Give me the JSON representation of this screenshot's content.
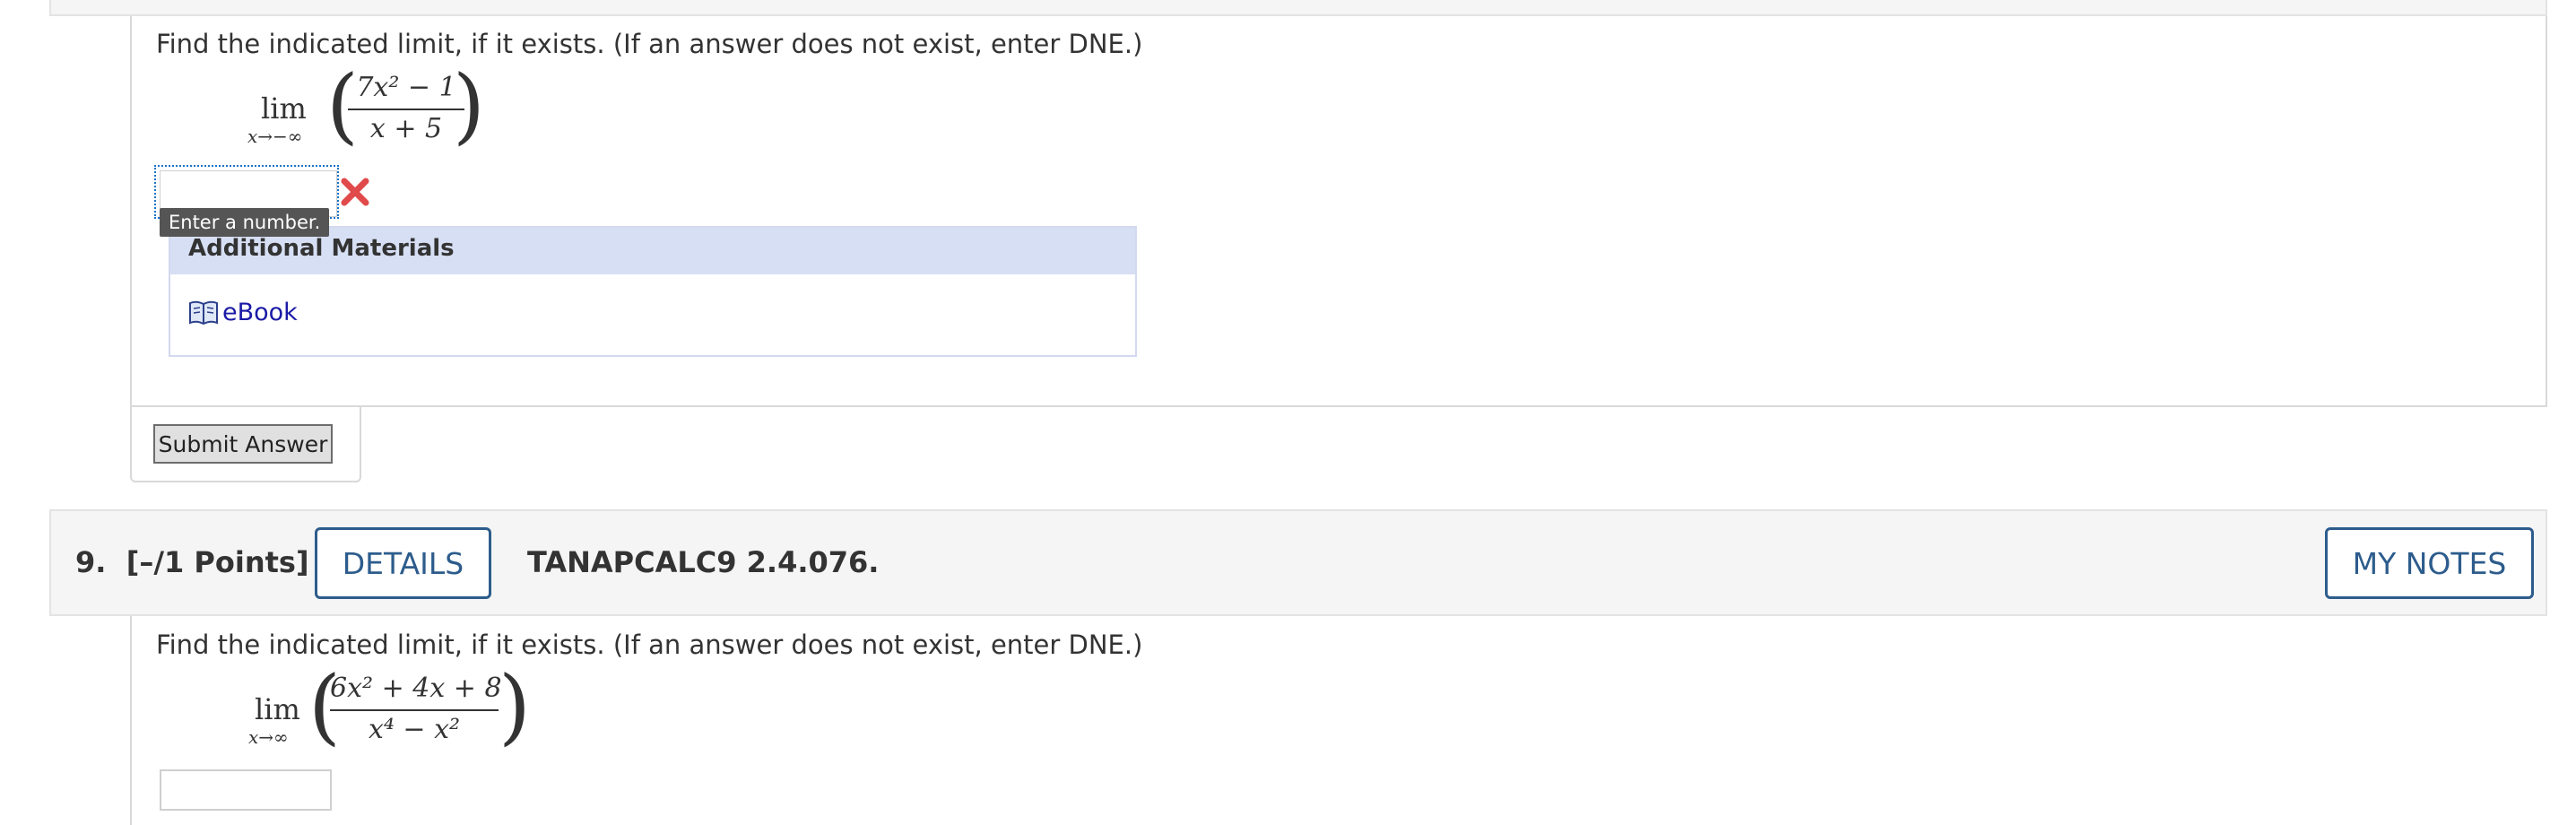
{
  "question8": {
    "prompt": "Find the indicated limit, if it exists. (If an answer does not exist, enter DNE.)",
    "limit": {
      "lim": "lim",
      "subscript": "x→−∞",
      "numerator": "7x² − 1",
      "denominator": "x + 5"
    },
    "answer_value": "",
    "tooltip": "Enter a number.",
    "additional_materials": {
      "title": "Additional Materials",
      "link_label": "eBook"
    },
    "submit_label": "Submit Answer",
    "status_icon": "incorrect-x-icon",
    "status_color": "#e04a4a"
  },
  "question9": {
    "number": "9.",
    "points": "[–/1 Points]",
    "details_label": "DETAILS",
    "code": "TANAPCALC9 2.4.076.",
    "my_notes_label": "MY NOTES",
    "prompt": "Find the indicated limit, if it exists. (If an answer does not exist, enter DNE.)",
    "limit": {
      "lim": "lim",
      "subscript": "x→∞",
      "numerator": "6x² + 4x + 8",
      "denominator": "x⁴ − x²"
    },
    "answer_value": ""
  },
  "colors": {
    "accent": "#2d5c8c",
    "header_bg": "#f5f5f5",
    "materials_header_bg": "#d7dff4",
    "link": "#1a1aa6"
  }
}
